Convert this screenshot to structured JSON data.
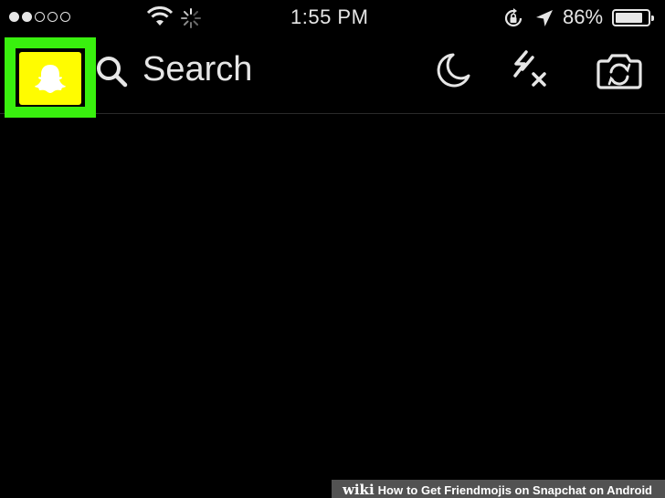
{
  "status_bar": {
    "signal_bars_filled": 2,
    "signal_bars_total": 5,
    "time": "1:55 PM",
    "battery_percent": "86%",
    "battery_level": 0.86
  },
  "header": {
    "search_label": "Search"
  },
  "highlight_color": "#39f00e",
  "brand_color": "#fffc00",
  "icons": [
    "ghost-icon",
    "search-icon",
    "moon-icon",
    "flash-off-icon",
    "camera-flip-icon"
  ],
  "watermark": {
    "logo": "wiki",
    "how": "How",
    "text": "to Get Friendmojis on Snapchat on Android"
  }
}
